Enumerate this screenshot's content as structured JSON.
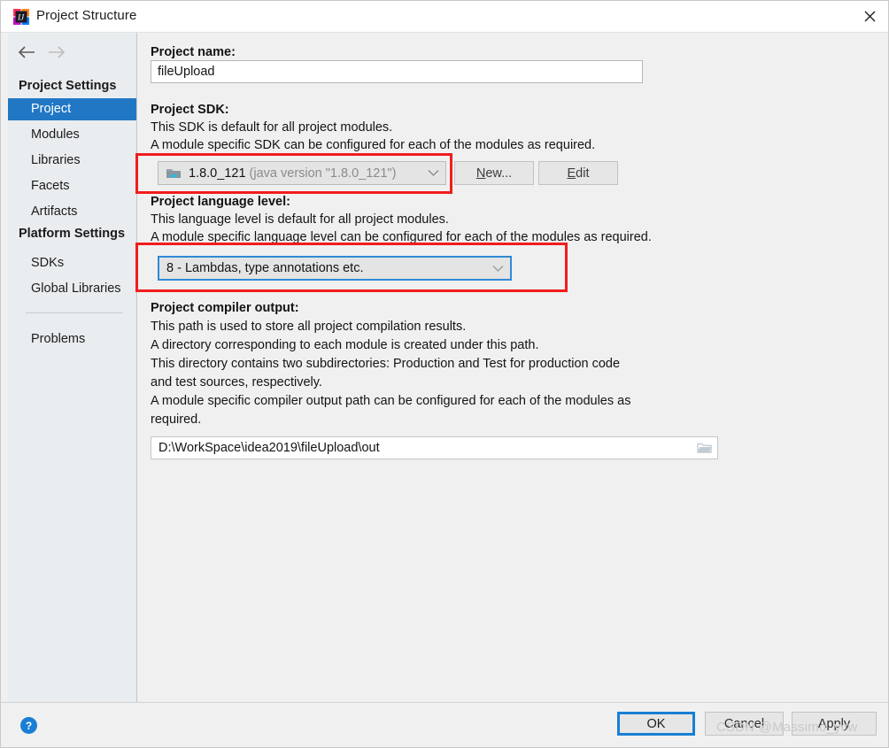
{
  "window": {
    "title": "Project Structure",
    "app_icon": "intellij-idea-logo",
    "close_icon": "close-icon"
  },
  "nav": {
    "back_icon": "arrow-left-icon",
    "forward_icon": "arrow-right-icon"
  },
  "sidebar": {
    "groups": [
      {
        "label": "Project Settings"
      },
      {
        "label": "Platform Settings"
      }
    ],
    "items": [
      {
        "label": "Project",
        "selected": true
      },
      {
        "label": "Modules",
        "selected": false
      },
      {
        "label": "Libraries",
        "selected": false
      },
      {
        "label": "Facets",
        "selected": false
      },
      {
        "label": "Artifacts",
        "selected": false
      },
      {
        "label": "SDKs",
        "selected": false
      },
      {
        "label": "Global Libraries",
        "selected": false
      },
      {
        "label": "Problems",
        "selected": false
      }
    ]
  },
  "main": {
    "project_name": {
      "label": "Project name:",
      "value": "fileUpload",
      "placeholder": ""
    },
    "project_sdk": {
      "label": "Project SDK:",
      "description_line1": "This SDK is default for all project modules.",
      "description_line2": "A module specific SDK can be configured for each of the modules as required.",
      "selected": "1.8.0_121",
      "selected_detail": "(java version \"1.8.0_121\")",
      "sdk_icon": "java-sdk-folder-icon",
      "chevron_icon": "chevron-down-icon",
      "new_button": "New...",
      "new_button_mnemonic": "N",
      "new_button_rest": "ew...",
      "edit_button": "Edit",
      "edit_button_mnemonic": "E",
      "edit_button_rest": "dit"
    },
    "language_level": {
      "label": "Project language level:",
      "description_line1": "This language level is default for all project modules.",
      "description_line2": "A module specific language level can be configured for each of the modules as required.",
      "selected": "8 - Lambdas, type annotations etc.",
      "chevron_icon": "chevron-down-icon"
    },
    "compiler_output": {
      "label": "Project compiler output:",
      "description_line1": "This path is used to store all project compilation results.",
      "description_line2": "A directory corresponding to each module is created under this path.",
      "description_line3": "This directory contains two subdirectories: Production and Test for production code",
      "description_line4": "and test sources, respectively.",
      "description_line5": "A module specific compiler output path can be configured for each of the modules as",
      "description_line6": "required.",
      "value": "D:\\WorkSpace\\idea2019\\fileUpload\\out",
      "browse_icon": "folder-browse-icon"
    }
  },
  "footer": {
    "help_icon": "help-question-icon",
    "ok": "OK",
    "cancel": "Cancel",
    "apply": "Apply"
  },
  "watermark": {
    "text": "CSDN @Massimo_ycw"
  },
  "colors": {
    "selection_blue": "#2277c4",
    "focus_blue": "#1a7fd4",
    "annotation_red": "#f01d1d",
    "sidebar_bg": "#e9edf0",
    "dialog_bg": "#f0f0f0"
  }
}
